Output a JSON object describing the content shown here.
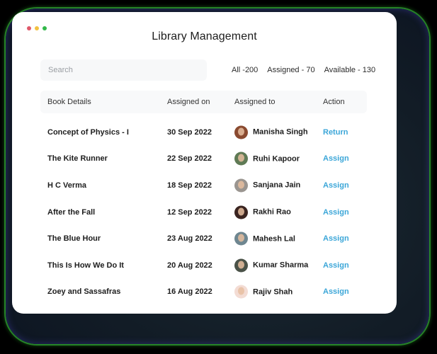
{
  "window": {
    "title": "Library Management",
    "controls": [
      {
        "name": "close",
        "color": "#e0596a"
      },
      {
        "name": "minimize",
        "color": "#f2c141"
      },
      {
        "name": "maximize",
        "color": "#32b84a"
      }
    ]
  },
  "search": {
    "placeholder": "Search",
    "value": ""
  },
  "filters": [
    {
      "label": "All -200"
    },
    {
      "label": "Assigned - 70"
    },
    {
      "label": "Available - 130"
    }
  ],
  "table": {
    "columns": [
      "Book Details",
      "Assigned on",
      "Assigned to",
      "Action"
    ],
    "rows": [
      {
        "book": "Concept of Physics - I",
        "assigned_on": "30 Sep 2022",
        "assigned_to": "Manisha Singh",
        "avatar_color": "#8a4a30",
        "action": "Return"
      },
      {
        "book": "The Kite Runner",
        "assigned_on": "22 Sep 2022",
        "assigned_to": "Ruhi Kapoor",
        "avatar_color": "#5f7a55",
        "action": "Assign"
      },
      {
        "book": "H C Verma",
        "assigned_on": "18 Sep 2022",
        "assigned_to": "Sanjana Jain",
        "avatar_color": "#9a9590",
        "action": "Assign"
      },
      {
        "book": "After the Fall",
        "assigned_on": "12 Sep 2022",
        "assigned_to": "Rakhi Rao",
        "avatar_color": "#3a2420",
        "action": "Assign"
      },
      {
        "book": "The Blue Hour",
        "assigned_on": "23 Aug 2022",
        "assigned_to": "Mahesh Lal",
        "avatar_color": "#6e8690",
        "action": "Assign"
      },
      {
        "book": "This Is How We Do It",
        "assigned_on": "20 Aug 2022",
        "assigned_to": "Kumar Sharma",
        "avatar_color": "#4a5248",
        "action": "Assign"
      },
      {
        "book": "Zoey and Sassafras",
        "assigned_on": "16 Aug 2022",
        "assigned_to": "Rajiv Shah",
        "avatar_color": "#f3dcd4",
        "action": "Assign"
      }
    ]
  },
  "colors": {
    "accent": "#3ba6d8",
    "header_bg": "#f8f9fa",
    "search_bg": "#f7f8f9"
  }
}
